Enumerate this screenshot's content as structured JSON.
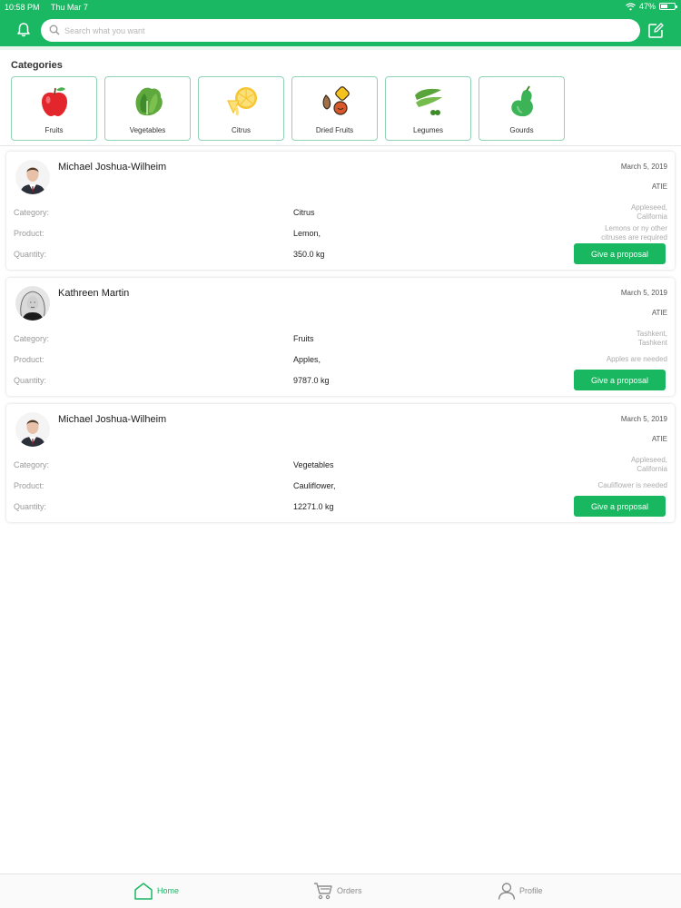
{
  "status": {
    "time": "10:58 PM",
    "date": "Thu Mar 7",
    "battery": "47%"
  },
  "search": {
    "placeholder": "Search what you want"
  },
  "categories_title": "Categories",
  "categories": [
    {
      "label": "Fruits",
      "icon": "apple-icon"
    },
    {
      "label": "Vegetables",
      "icon": "lettuce-icon"
    },
    {
      "label": "Citrus",
      "icon": "lemon-icon"
    },
    {
      "label": "Dried Fruits",
      "icon": "dried-fruits-icon"
    },
    {
      "label": "Legumes",
      "icon": "pea-pod-icon"
    },
    {
      "label": "Gourds",
      "icon": "gourd-icon"
    }
  ],
  "field_labels": {
    "category": "Category:",
    "product": "Product:",
    "quantity": "Quantity:"
  },
  "requests": [
    {
      "name": "Michael Joshua-Wilheim",
      "date": "March 5, 2019",
      "org": "ATIE",
      "category": "Citrus",
      "product": "Lemon,",
      "quantity": "350.0 kg",
      "location_1": "Appleseed,",
      "location_2": "California",
      "note_1": "Lemons or ny other",
      "note_2": "citruses are required",
      "button": "Give a proposal"
    },
    {
      "name": "Kathreen Martin",
      "date": "March 5, 2019",
      "org": "ATIE",
      "category": "Fruits",
      "product": "Apples,",
      "quantity": "9787.0 kg",
      "location_1": "Tashkent,",
      "location_2": "Tashkent",
      "note_1": "Apples are needed",
      "note_2": "",
      "button": "Give a proposal"
    },
    {
      "name": "Michael Joshua-Wilheim",
      "date": "March 5, 2019",
      "org": "ATIE",
      "category": "Vegetables",
      "product": "Cauliflower,",
      "quantity": "12271.0 kg",
      "location_1": "Appleseed,",
      "location_2": "California",
      "note_1": "Cauliflower is needed",
      "note_2": "",
      "button": "Give a proposal"
    }
  ],
  "tabs": [
    {
      "label": "Home",
      "icon": "home-icon",
      "active": true
    },
    {
      "label": "Orders",
      "icon": "cart-icon",
      "active": false
    },
    {
      "label": "Profile",
      "icon": "user-icon",
      "active": false
    }
  ],
  "colors": {
    "brand": "#1bb863",
    "button": "#19b860",
    "category_border": "#8fd3b5",
    "tab_active": "#1bb863",
    "tab_inactive": "#8c8c8c"
  }
}
